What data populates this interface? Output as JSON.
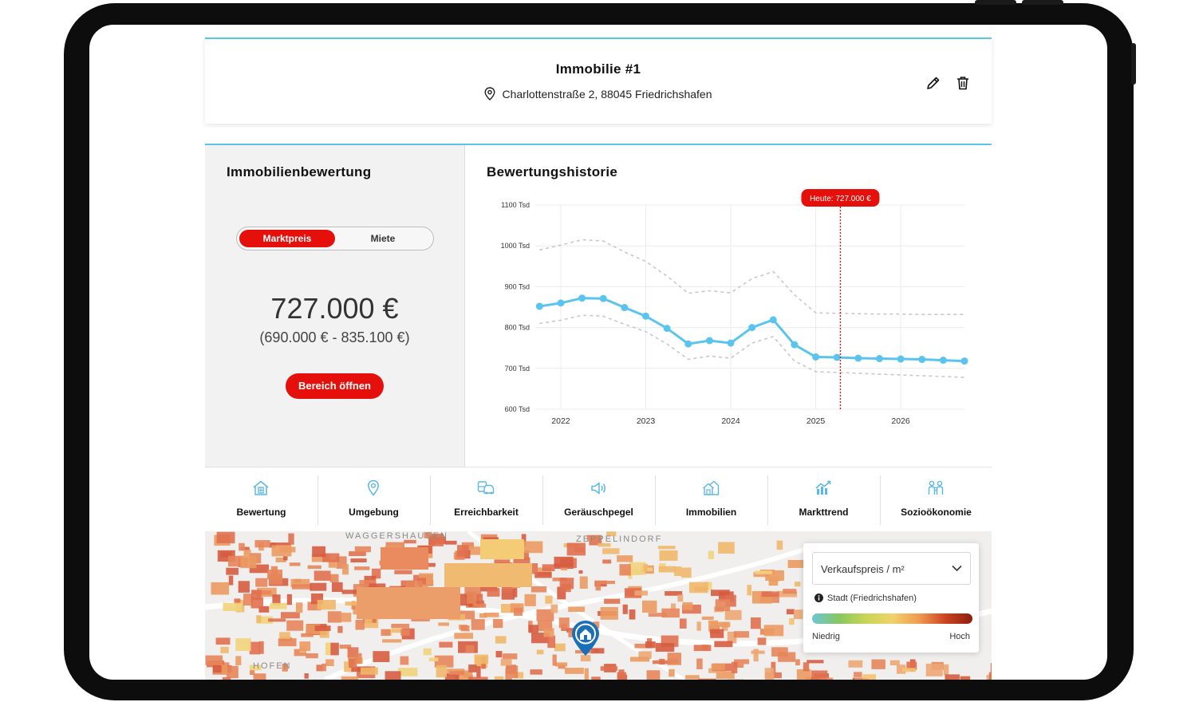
{
  "property": {
    "title": "Immobilie #1",
    "address": "Charlottenstraße 2, 88045 Friedrichshafen"
  },
  "valuation": {
    "title": "Immobilienbewertung",
    "toggle": [
      "Marktpreis",
      "Miete"
    ],
    "active_toggle": "Marktpreis",
    "price": "727.000 €",
    "range": "(690.000 € - 835.100 €)",
    "open_button": "Bereich öffnen"
  },
  "history": {
    "title": "Bewertungshistorie",
    "today_label": "Heute: 727.000 €"
  },
  "chart_data": {
    "type": "line",
    "title": "Bewertungshistorie",
    "y_unit": "Tsd",
    "ylim": [
      600,
      1100
    ],
    "yticks": [
      600,
      700,
      800,
      900,
      1000,
      1100
    ],
    "ytick_labels": [
      "600 Tsd",
      "700 Tsd",
      "800 Tsd",
      "900 Tsd",
      "1000 Tsd",
      "1100 Tsd"
    ],
    "xlim": [
      2021.7,
      2026.75
    ],
    "xticks": [
      2022,
      2023,
      2024,
      2025,
      2026
    ],
    "xtick_labels": [
      "2022",
      "2023",
      "2024",
      "2025",
      "2026"
    ],
    "today_x": 2025.29,
    "grid": true,
    "series": [
      {
        "role": "estimate",
        "style": "solid-dots",
        "x": [
          2021.75,
          2022.0,
          2022.25,
          2022.5,
          2022.75,
          2023.0,
          2023.25,
          2023.5,
          2023.75,
          2024.0,
          2024.25,
          2024.5,
          2024.75,
          2025.0,
          2025.25,
          2025.5,
          2025.75,
          2026.0,
          2026.25,
          2026.5,
          2026.75
        ],
        "y": [
          852,
          860,
          872,
          871,
          849,
          828,
          798,
          760,
          768,
          762,
          800,
          819,
          758,
          728,
          727,
          725,
          724,
          723,
          722,
          720,
          718
        ]
      },
      {
        "role": "upper",
        "style": "dashed",
        "x": [
          2021.75,
          2022.0,
          2022.25,
          2022.5,
          2022.75,
          2023.0,
          2023.25,
          2023.5,
          2023.75,
          2024.0,
          2024.25,
          2024.5,
          2024.75,
          2025.0,
          2025.25,
          2025.5,
          2025.75,
          2026.0,
          2026.25,
          2026.5,
          2026.75
        ],
        "y": [
          990,
          1002,
          1015,
          1012,
          985,
          962,
          926,
          884,
          890,
          885,
          920,
          937,
          880,
          836,
          835,
          834,
          833,
          833,
          832,
          832,
          832
        ]
      },
      {
        "role": "lower",
        "style": "dashed",
        "x": [
          2021.75,
          2022.0,
          2022.25,
          2022.5,
          2022.75,
          2023.0,
          2023.25,
          2023.5,
          2023.75,
          2024.0,
          2024.25,
          2024.5,
          2024.75,
          2025.0,
          2025.25,
          2025.5,
          2025.75,
          2026.0,
          2026.25,
          2026.5,
          2026.75
        ],
        "y": [
          810,
          818,
          830,
          828,
          808,
          790,
          760,
          722,
          730,
          725,
          762,
          778,
          718,
          692,
          690,
          688,
          686,
          684,
          682,
          680,
          678
        ]
      }
    ]
  },
  "tabs": [
    {
      "label": "Bewertung",
      "icon": "house-calculator-icon"
    },
    {
      "label": "Umgebung",
      "icon": "location-pin-icon"
    },
    {
      "label": "Erreichbarkeit",
      "icon": "transport-icon"
    },
    {
      "label": "Geräuschpegel",
      "icon": "speaker-icon"
    },
    {
      "label": "Immobilien",
      "icon": "houses-icon"
    },
    {
      "label": "Markttrend",
      "icon": "trend-chart-icon"
    },
    {
      "label": "Sozioökonomie",
      "icon": "people-icon"
    }
  ],
  "map": {
    "labels": [
      "WAGGERSHAUSEN",
      "ZEPPELINDORF",
      "HOFEN"
    ],
    "legend": {
      "select_value": "Verkaufspreis / m²",
      "city": "Stadt (Friedrichshafen)",
      "low": "Niedrig",
      "high": "Hoch"
    }
  },
  "colors": {
    "accent_red": "#e5100c",
    "series_blue": "#5bc4ee",
    "band_gray": "#c8c8c8",
    "header_line_blue": "#5cc3ec"
  }
}
